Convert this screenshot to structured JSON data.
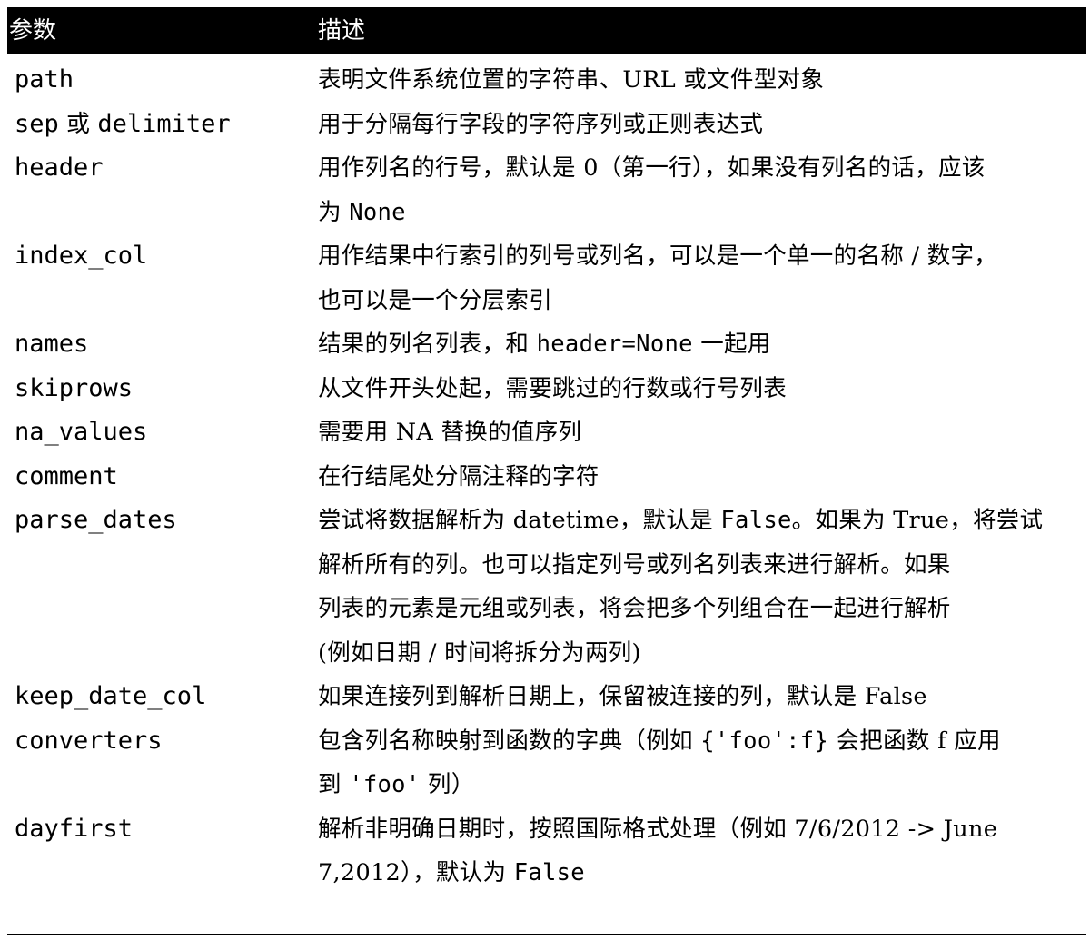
{
  "table": {
    "header": {
      "param": "参数",
      "desc": "描述"
    },
    "rows": [
      {
        "param_parts": [
          {
            "t": "path",
            "code": true
          }
        ],
        "lines": [
          [
            {
              "t": "表明文件系统位置的字符串、URL 或文件型对象"
            }
          ]
        ]
      },
      {
        "param_parts": [
          {
            "t": "sep",
            "code": true
          },
          {
            "t": " 或 ",
            "code": false
          },
          {
            "t": "delimiter",
            "code": true
          }
        ],
        "lines": [
          [
            {
              "t": "用于分隔每行字段的字符序列或正则表达式"
            }
          ]
        ]
      },
      {
        "param_parts": [
          {
            "t": "header",
            "code": true
          }
        ],
        "lines": [
          [
            {
              "t": "用作列名的行号，默认是 0（第一行），如果没有列名的话，应该"
            }
          ],
          [
            {
              "t": "为 "
            },
            {
              "t": "None",
              "code": true
            }
          ]
        ]
      },
      {
        "param_parts": [
          {
            "t": "index_col",
            "code": true
          }
        ],
        "lines": [
          [
            {
              "t": "用作结果中行索引的列号或列名，可以是一个单一的名称 / 数字，"
            }
          ],
          [
            {
              "t": "也可以是一个分层索引"
            }
          ]
        ]
      },
      {
        "param_parts": [
          {
            "t": "names",
            "code": true
          }
        ],
        "lines": [
          [
            {
              "t": "结果的列名列表，和 "
            },
            {
              "t": "header=None",
              "code": true
            },
            {
              "t": " 一起用"
            }
          ]
        ]
      },
      {
        "param_parts": [
          {
            "t": "skiprows",
            "code": true
          }
        ],
        "lines": [
          [
            {
              "t": "从文件开头处起，需要跳过的行数或行号列表"
            }
          ]
        ]
      },
      {
        "param_parts": [
          {
            "t": "na_values",
            "code": true
          }
        ],
        "lines": [
          [
            {
              "t": "需要用 NA 替换的值序列"
            }
          ]
        ]
      },
      {
        "param_parts": [
          {
            "t": "comment",
            "code": true
          }
        ],
        "lines": [
          [
            {
              "t": "在行结尾处分隔注释的字符"
            }
          ]
        ]
      },
      {
        "param_parts": [
          {
            "t": "parse_dates",
            "code": true
          }
        ],
        "lines": [
          [
            {
              "t": "尝试将数据解析为 datetime，默认是 "
            },
            {
              "t": "False",
              "code": true
            },
            {
              "t": "。如果为 True，将尝试"
            }
          ],
          [
            {
              "t": "解析所有的列。也可以指定列号或列名列表来进行解析。如果"
            }
          ],
          [
            {
              "t": "列表的元素是元组或列表，将会把多个列组合在一起进行解析"
            }
          ],
          [
            {
              "t": "(例如日期 / 时间将拆分为两列)"
            }
          ]
        ]
      },
      {
        "param_parts": [
          {
            "t": "keep_date_col",
            "code": true
          }
        ],
        "lines": [
          [
            {
              "t": "如果连接列到解析日期上，保留被连接的列，默认是 False"
            }
          ]
        ]
      },
      {
        "param_parts": [
          {
            "t": "converters",
            "code": true
          }
        ],
        "lines": [
          [
            {
              "t": "包含列名称映射到函数的字典（例如 "
            },
            {
              "t": "{'foo':f}",
              "code": true
            },
            {
              "t": " 会把函数 f 应用"
            }
          ],
          [
            {
              "t": "到 "
            },
            {
              "t": "'foo'",
              "code": true
            },
            {
              "t": " 列）"
            }
          ]
        ]
      },
      {
        "param_parts": [
          {
            "t": "dayfirst",
            "code": true
          }
        ],
        "lines": [
          [
            {
              "t": "解析非明确日期时，按照国际格式处理（例如 7/6/2012 -> June"
            }
          ],
          [
            {
              "t": "7,2012），默认为 "
            },
            {
              "t": "False",
              "code": true
            }
          ]
        ]
      }
    ]
  }
}
